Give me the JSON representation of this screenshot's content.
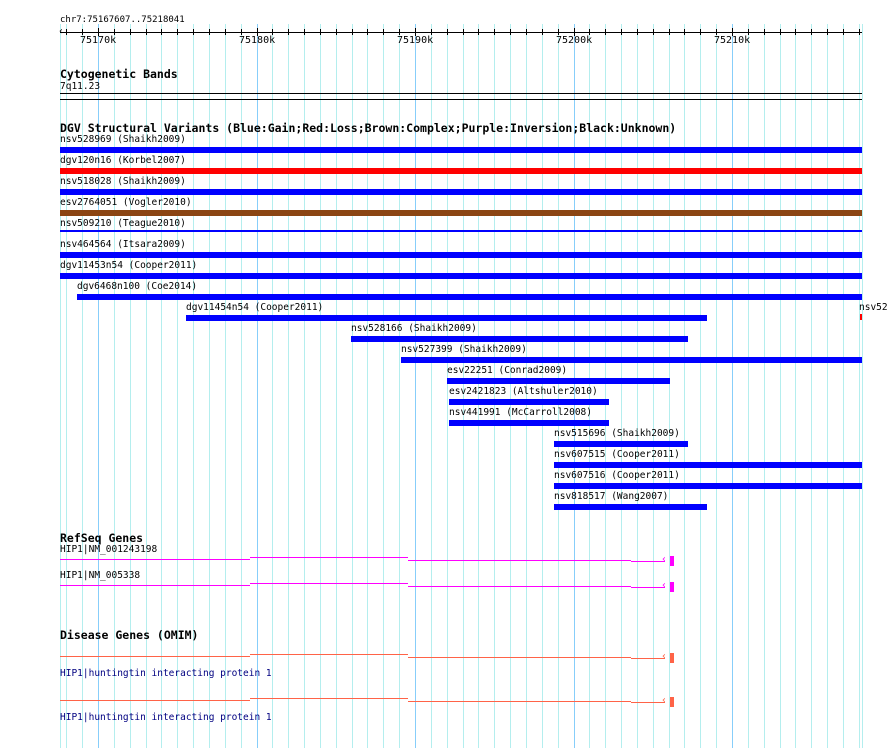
{
  "ruler": {
    "range": "chr7:75167607..75218041",
    "ticks": [
      "75170k",
      "75180k",
      "75190k",
      "75200k",
      "75210k"
    ]
  },
  "cyto": {
    "title": "Cytogenetic Bands",
    "band": "7q11.23"
  },
  "dgv": {
    "title": "DGV Structural Variants (Blue:Gain;Red:Loss;Brown:Complex;Purple:Inversion;Black:Unknown)",
    "items": [
      {
        "label": "nsv528969 (Shaikh2009)",
        "type": "Gain"
      },
      {
        "label": "dgv120n16 (Korbel2007)",
        "type": "Loss"
      },
      {
        "label": "nsv518028 (Shaikh2009)",
        "type": "Gain"
      },
      {
        "label": "esv2764051 (Vogler2010)",
        "type": "Complex"
      },
      {
        "label": "nsv509210 (Teague2010)",
        "type": "Gain"
      },
      {
        "label": "nsv464564 (Itsara2009)",
        "type": "Gain"
      },
      {
        "label": "dgv11453n54 (Cooper2011)",
        "type": "Gain"
      },
      {
        "label": "dgv6468n100 (Coe2014)",
        "type": "Gain"
      },
      {
        "label": "dgv11454n54 (Cooper2011)",
        "type": "Gain"
      },
      {
        "label": "nsv528166 (Shaikh2009)",
        "type": "Gain"
      },
      {
        "label": "nsv527399 (Shaikh2009)",
        "type": "Gain"
      },
      {
        "label": "esv22251 (Conrad2009)",
        "type": "Gain"
      },
      {
        "label": "esv2421823 (Altshuler2010)",
        "type": "Gain"
      },
      {
        "label": "nsv441991 (McCarroll2008)",
        "type": "Gain"
      },
      {
        "label": "nsv515696 (Shaikh2009)",
        "type": "Gain"
      },
      {
        "label": "nsv607515 (Cooper2011)",
        "type": "Gain"
      },
      {
        "label": "nsv607516 (Cooper2011)",
        "type": "Gain"
      },
      {
        "label": "nsv818517 (Wang2007)",
        "type": "Gain"
      }
    ],
    "overflow_label": "nsv52"
  },
  "refseq": {
    "title": "RefSeq Genes",
    "genes": [
      {
        "label": "HIP1|NM_001243198"
      },
      {
        "label": "HIP1|NM_005338"
      }
    ]
  },
  "omim": {
    "title": "Disease Genes (OMIM)",
    "genes": [
      {
        "label": "HIP1|huntingtin interacting protein 1"
      },
      {
        "label": "HIP1|huntingtin interacting protein 1"
      }
    ]
  },
  "colors": {
    "Gain": "#0000ff",
    "Loss": "#ff0000",
    "Complex": "#8b4513",
    "refseq": "#ff00ff",
    "omim": "#ff6347",
    "omim_label": "#000080"
  }
}
